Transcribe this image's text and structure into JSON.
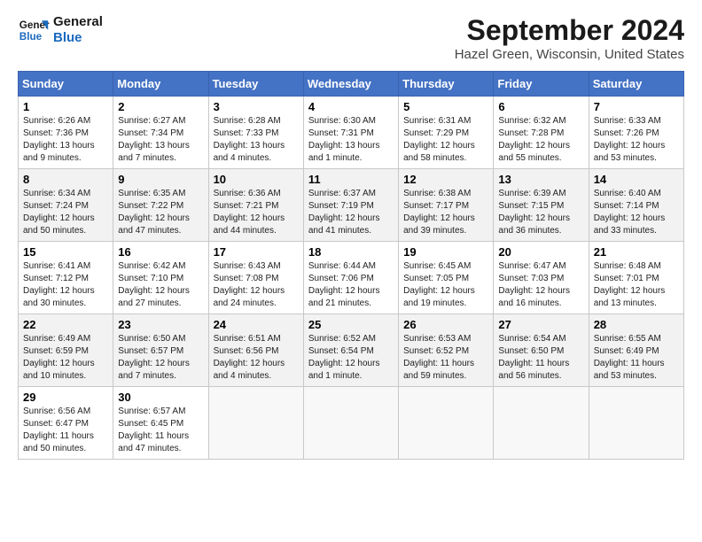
{
  "header": {
    "logo_line1": "General",
    "logo_line2": "Blue",
    "month_year": "September 2024",
    "location": "Hazel Green, Wisconsin, United States"
  },
  "weekdays": [
    "Sunday",
    "Monday",
    "Tuesday",
    "Wednesday",
    "Thursday",
    "Friday",
    "Saturday"
  ],
  "weeks": [
    [
      {
        "day": "1",
        "sunrise": "6:26 AM",
        "sunset": "7:36 PM",
        "daylight": "13 hours and 9 minutes."
      },
      {
        "day": "2",
        "sunrise": "6:27 AM",
        "sunset": "7:34 PM",
        "daylight": "13 hours and 7 minutes."
      },
      {
        "day": "3",
        "sunrise": "6:28 AM",
        "sunset": "7:33 PM",
        "daylight": "13 hours and 4 minutes."
      },
      {
        "day": "4",
        "sunrise": "6:30 AM",
        "sunset": "7:31 PM",
        "daylight": "13 hours and 1 minute."
      },
      {
        "day": "5",
        "sunrise": "6:31 AM",
        "sunset": "7:29 PM",
        "daylight": "12 hours and 58 minutes."
      },
      {
        "day": "6",
        "sunrise": "6:32 AM",
        "sunset": "7:28 PM",
        "daylight": "12 hours and 55 minutes."
      },
      {
        "day": "7",
        "sunrise": "6:33 AM",
        "sunset": "7:26 PM",
        "daylight": "12 hours and 53 minutes."
      }
    ],
    [
      {
        "day": "8",
        "sunrise": "6:34 AM",
        "sunset": "7:24 PM",
        "daylight": "12 hours and 50 minutes."
      },
      {
        "day": "9",
        "sunrise": "6:35 AM",
        "sunset": "7:22 PM",
        "daylight": "12 hours and 47 minutes."
      },
      {
        "day": "10",
        "sunrise": "6:36 AM",
        "sunset": "7:21 PM",
        "daylight": "12 hours and 44 minutes."
      },
      {
        "day": "11",
        "sunrise": "6:37 AM",
        "sunset": "7:19 PM",
        "daylight": "12 hours and 41 minutes."
      },
      {
        "day": "12",
        "sunrise": "6:38 AM",
        "sunset": "7:17 PM",
        "daylight": "12 hours and 39 minutes."
      },
      {
        "day": "13",
        "sunrise": "6:39 AM",
        "sunset": "7:15 PM",
        "daylight": "12 hours and 36 minutes."
      },
      {
        "day": "14",
        "sunrise": "6:40 AM",
        "sunset": "7:14 PM",
        "daylight": "12 hours and 33 minutes."
      }
    ],
    [
      {
        "day": "15",
        "sunrise": "6:41 AM",
        "sunset": "7:12 PM",
        "daylight": "12 hours and 30 minutes."
      },
      {
        "day": "16",
        "sunrise": "6:42 AM",
        "sunset": "7:10 PM",
        "daylight": "12 hours and 27 minutes."
      },
      {
        "day": "17",
        "sunrise": "6:43 AM",
        "sunset": "7:08 PM",
        "daylight": "12 hours and 24 minutes."
      },
      {
        "day": "18",
        "sunrise": "6:44 AM",
        "sunset": "7:06 PM",
        "daylight": "12 hours and 21 minutes."
      },
      {
        "day": "19",
        "sunrise": "6:45 AM",
        "sunset": "7:05 PM",
        "daylight": "12 hours and 19 minutes."
      },
      {
        "day": "20",
        "sunrise": "6:47 AM",
        "sunset": "7:03 PM",
        "daylight": "12 hours and 16 minutes."
      },
      {
        "day": "21",
        "sunrise": "6:48 AM",
        "sunset": "7:01 PM",
        "daylight": "12 hours and 13 minutes."
      }
    ],
    [
      {
        "day": "22",
        "sunrise": "6:49 AM",
        "sunset": "6:59 PM",
        "daylight": "12 hours and 10 minutes."
      },
      {
        "day": "23",
        "sunrise": "6:50 AM",
        "sunset": "6:57 PM",
        "daylight": "12 hours and 7 minutes."
      },
      {
        "day": "24",
        "sunrise": "6:51 AM",
        "sunset": "6:56 PM",
        "daylight": "12 hours and 4 minutes."
      },
      {
        "day": "25",
        "sunrise": "6:52 AM",
        "sunset": "6:54 PM",
        "daylight": "12 hours and 1 minute."
      },
      {
        "day": "26",
        "sunrise": "6:53 AM",
        "sunset": "6:52 PM",
        "daylight": "11 hours and 59 minutes."
      },
      {
        "day": "27",
        "sunrise": "6:54 AM",
        "sunset": "6:50 PM",
        "daylight": "11 hours and 56 minutes."
      },
      {
        "day": "28",
        "sunrise": "6:55 AM",
        "sunset": "6:49 PM",
        "daylight": "11 hours and 53 minutes."
      }
    ],
    [
      {
        "day": "29",
        "sunrise": "6:56 AM",
        "sunset": "6:47 PM",
        "daylight": "11 hours and 50 minutes."
      },
      {
        "day": "30",
        "sunrise": "6:57 AM",
        "sunset": "6:45 PM",
        "daylight": "11 hours and 47 minutes."
      },
      null,
      null,
      null,
      null,
      null
    ]
  ]
}
